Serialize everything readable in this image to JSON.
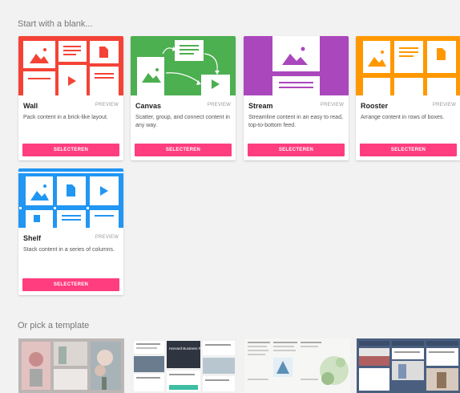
{
  "blank_section": {
    "title": "Start with a blank..."
  },
  "template_section": {
    "title": "Or pick a template"
  },
  "colors": {
    "wall": "#f44336",
    "canvas": "#4caf50",
    "stream": "#ab47bc",
    "rooster": "#ff9800",
    "shelf": "#2196f3",
    "button": "#ff3d7f"
  },
  "layouts": [
    {
      "name": "Wall",
      "badge": "PREVIEW",
      "description": "Pack content in a brick-like layout.",
      "button": "SELECTEREN"
    },
    {
      "name": "Canvas",
      "badge": "PREVIEW",
      "description": "Scatter, group, and connect content in any way.",
      "button": "SELECTEREN"
    },
    {
      "name": "Stream",
      "badge": "PREVIEW",
      "description": "Streamline content in an easy to read, top-to-bottom feed.",
      "button": "SELECTEREN"
    },
    {
      "name": "Rooster",
      "badge": "PREVIEW",
      "description": "Arrange content in rows of boxes.",
      "button": "SELECTEREN"
    },
    {
      "name": "Shelf",
      "badge": "PREVIEW",
      "description": "Stack content in a series of columns.",
      "button": "SELECTEREN"
    }
  ],
  "templates": [
    {
      "name": "template-photo-grid"
    },
    {
      "name": "template-business-review",
      "text": "Harvard Business Review"
    },
    {
      "name": "template-note-stream"
    },
    {
      "name": "template-dark-shelf"
    }
  ]
}
